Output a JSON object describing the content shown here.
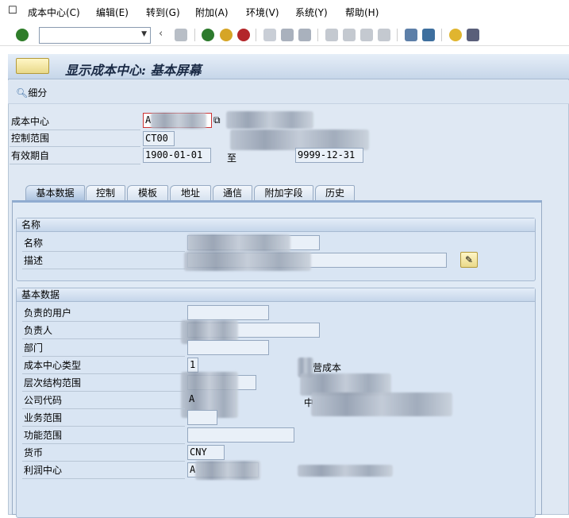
{
  "menu": {
    "items": [
      "成本中心(C)",
      "编辑(E)",
      "转到(G)",
      "附加(A)",
      "环境(V)",
      "系统(Y)",
      "帮助(H)"
    ]
  },
  "toolbar": {
    "command_value": ""
  },
  "title": "显示成本中心: 基本屏幕",
  "appbar": {
    "detail_label": "细分"
  },
  "header": {
    "cost_center_label": "成本中心",
    "cost_center_value": "A",
    "controlling_area_label": "控制范围",
    "controlling_area_value": "CT00",
    "valid_from_label": "有效期自",
    "valid_from": "1900-01-01",
    "to_label": "至",
    "valid_to": "9999-12-31"
  },
  "tabs": [
    "基本数据",
    "控制",
    "模板",
    "地址",
    "通信",
    "附加字段",
    "历史"
  ],
  "name_group": {
    "title": "名称",
    "name_label": "名称",
    "desc_label": "描述"
  },
  "basic_group": {
    "title": "基本数据",
    "rows": [
      {
        "label": "负责的用户",
        "value": ""
      },
      {
        "label": "负责人",
        "value": ""
      },
      {
        "label": "部门",
        "value": ""
      },
      {
        "label": "成本中心类型",
        "value": "1",
        "desc": "营成本"
      },
      {
        "label": "层次结构范围",
        "value": ""
      },
      {
        "label": "公司代码",
        "value": "A",
        "desc": "中"
      },
      {
        "label": "业务范围",
        "value": ""
      },
      {
        "label": "功能范围",
        "value": ""
      },
      {
        "label": "货币",
        "value": "CNY"
      },
      {
        "label": "利润中心",
        "value": "A"
      }
    ]
  }
}
